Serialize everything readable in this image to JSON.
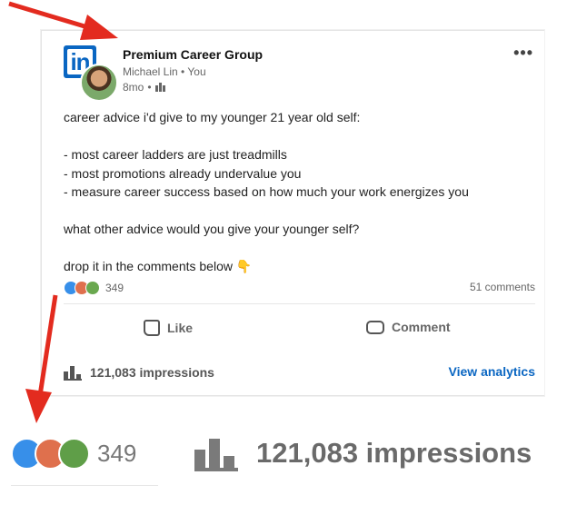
{
  "post": {
    "company": "Premium Career Group",
    "author": "Michael Lin",
    "relation": "You",
    "age": "8mo",
    "visibility_icon": "company-visibility-icon",
    "body": {
      "line1": "career advice i'd give to my younger 21 year old self:",
      "line2": "- most career ladders are just treadmills",
      "line3": "- most promotions already undervalue you",
      "line4": "- measure career success based on how much your work energizes you",
      "line5": "what other advice would you give your younger self?",
      "line6": "drop it in the comments below 👇"
    },
    "reactions_count": "349",
    "comments": "51 comments",
    "actions": {
      "like": "Like",
      "comment": "Comment"
    },
    "impressions": "121,083 impressions",
    "view_analytics": "View analytics",
    "more": "•••"
  },
  "zoom": {
    "reactions_count": "349",
    "impressions": "121,083 impressions"
  },
  "colors": {
    "brand": "#0a66c2",
    "annotation_arrow": "#e32b1f",
    "like": "#378fe9",
    "love": "#df704d",
    "insightful": "#6aa84f"
  }
}
